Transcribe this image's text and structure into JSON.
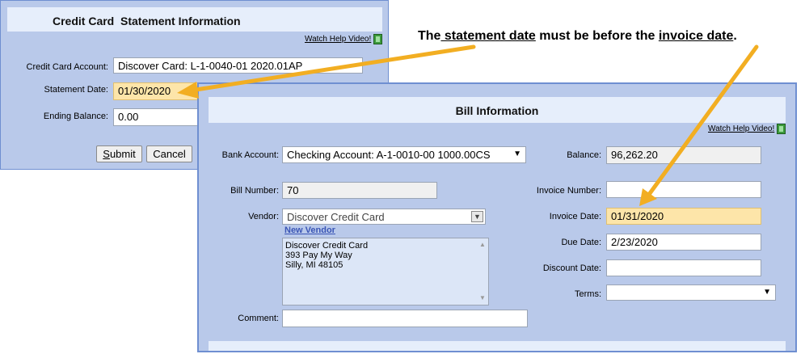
{
  "annotation": {
    "prefix": "The",
    "statement_date": " statement date",
    "middle": " must be before the ",
    "invoice_date": "invoice date",
    "suffix": "."
  },
  "colors": {
    "arrow": "#f2ae22",
    "panel": "#b9c9ea",
    "header": "#e6eefb",
    "highlight": "#fde5a9"
  },
  "cc_panel": {
    "title": "Credit Card  Statement Information",
    "help_label": "Watch Help Video!",
    "credit_card_account_label": "Credit Card Account:",
    "credit_card_account_value": "Discover Card: L-1-0040-01 2020.01AP",
    "statement_date_label": "Statement Date:",
    "statement_date_value": "01/30/2020",
    "ending_balance_label": "Ending Balance:",
    "ending_balance_value": "0.00",
    "submit_rest": "ubmit",
    "submit_hotkey": "S",
    "cancel_label": "Cancel"
  },
  "bill_panel": {
    "title": "Bill Information",
    "help_label": "Watch Help Video!",
    "bank_account_label": "Bank Account:",
    "bank_account_value": "Checking Account: A-1-0010-00 1000.00CS",
    "balance_label": "Balance:",
    "balance_value": "96,262.20",
    "bill_number_label": "Bill Number:",
    "bill_number_value": "70",
    "invoice_number_label": "Invoice Number:",
    "invoice_number_value": "",
    "vendor_label": "Vendor:",
    "vendor_value": "Discover Credit Card",
    "new_vendor_link": "New Vendor",
    "invoice_date_label": "Invoice Date:",
    "invoice_date_value": "01/31/2020",
    "vendor_address": [
      "Discover Credit Card",
      "393 Pay My Way",
      "Silly, MI 48105"
    ],
    "due_date_label": "Due Date:",
    "due_date_value": "2/23/2020",
    "discount_date_label": "Discount Date:",
    "discount_date_value": "",
    "terms_label": "Terms:",
    "terms_value": "",
    "comment_label": "Comment:",
    "comment_value": ""
  }
}
